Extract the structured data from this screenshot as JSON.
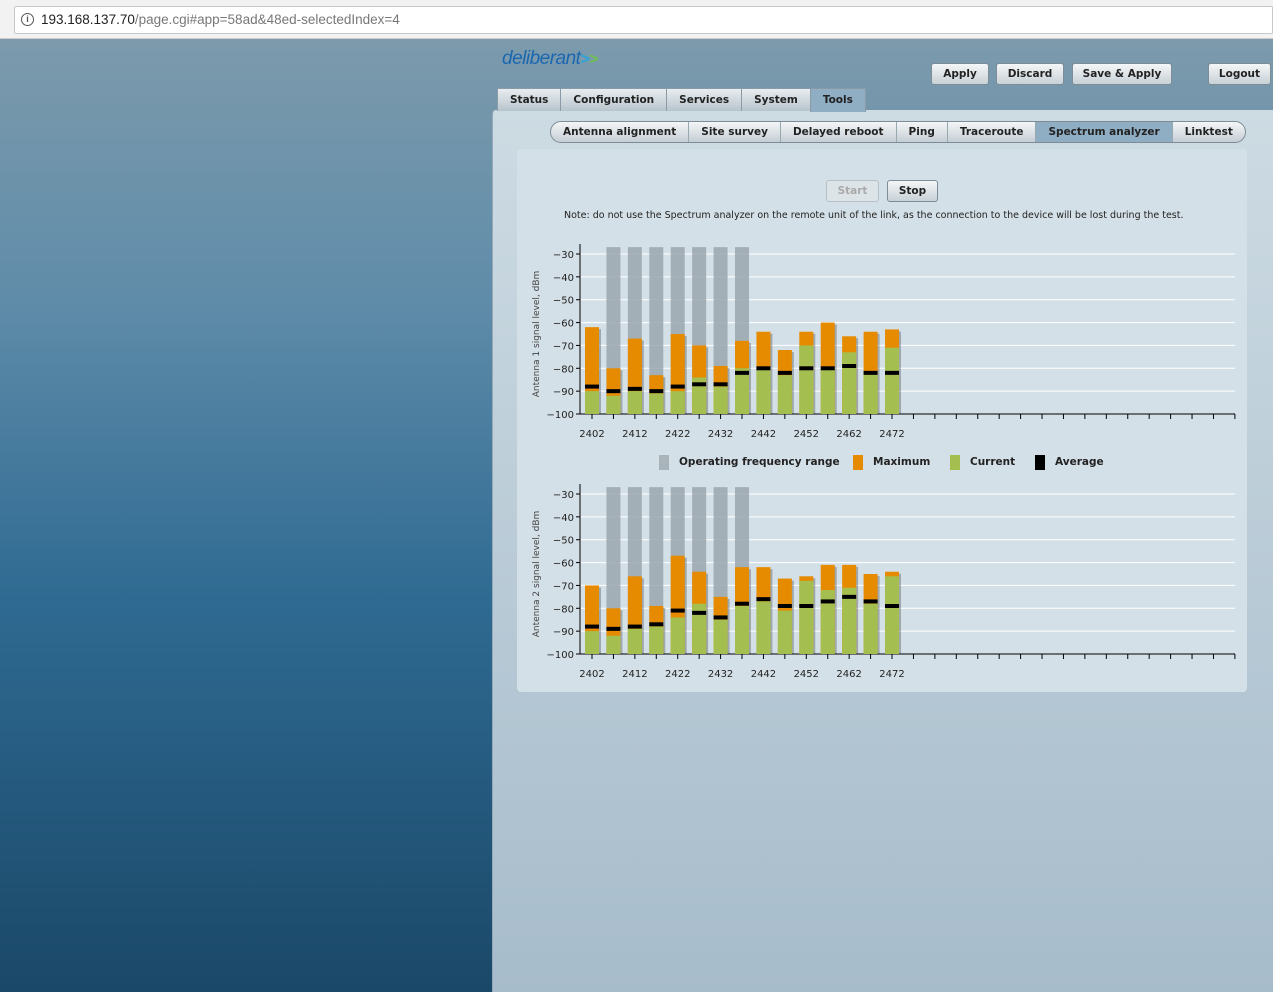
{
  "browser": {
    "url_host": "193.168.137.70",
    "url_path": "/page.cgi#app=58ad&48ed-selectedIndex=4"
  },
  "logo": "deliberant",
  "toolbar": {
    "apply": "Apply",
    "discard": "Discard",
    "save_apply": "Save & Apply",
    "logout": "Logout"
  },
  "tabs": [
    "Status",
    "Configuration",
    "Services",
    "System",
    "Tools"
  ],
  "active_tab": "Tools",
  "subtabs": [
    "Antenna alignment",
    "Site survey",
    "Delayed reboot",
    "Ping",
    "Traceroute",
    "Spectrum analyzer",
    "Linktest"
  ],
  "active_subtab": "Spectrum analyzer",
  "controls": {
    "start": "Start",
    "stop": "Stop"
  },
  "note": "Note: do not use the Spectrum analyzer on the remote unit of the link, as the connection to the device will be lost during the test.",
  "legend": {
    "operating": "Operating frequency range",
    "maximum": "Maximum",
    "current": "Current",
    "average": "Average"
  },
  "colors": {
    "operating": "#9aa6ae",
    "maximum": "#e68a00",
    "current": "#a5be50",
    "average": "#000000"
  },
  "chart_data": [
    {
      "type": "bar",
      "ylabel": "Antenna 1 signal level, dBm",
      "ylim": [
        -100,
        -30
      ],
      "yticks": [
        -30,
        -40,
        -50,
        -60,
        -70,
        -80,
        -90,
        -100
      ],
      "x": [
        2402,
        2407,
        2412,
        2417,
        2422,
        2427,
        2432,
        2437,
        2442,
        2447,
        2452,
        2457,
        2462,
        2467,
        2472
      ],
      "xtick_labels": [
        "2402",
        "2412",
        "2422",
        "2432",
        "2442",
        "2452",
        "2462",
        "2472"
      ],
      "operating_range": [
        2407,
        2437
      ],
      "operating_top": -27,
      "series": [
        {
          "name": "Maximum",
          "values": [
            -62,
            -80,
            -67,
            -83,
            -65,
            -70,
            -79,
            -68,
            -64,
            -72,
            -64,
            -60,
            -66,
            -64,
            -63
          ]
        },
        {
          "name": "Current",
          "values": [
            -90,
            -92,
            -90,
            -91,
            -90,
            -84,
            -88,
            -80,
            -80,
            -83,
            -70,
            -80,
            -73,
            -82,
            -71
          ]
        },
        {
          "name": "Average",
          "values": [
            -88,
            -90,
            -89,
            -90,
            -88,
            -87,
            -87,
            -82,
            -80,
            -82,
            -80,
            -80,
            -79,
            -82,
            -82
          ]
        }
      ]
    },
    {
      "type": "bar",
      "ylabel": "Antenna 2 signal level, dBm",
      "ylim": [
        -100,
        -30
      ],
      "yticks": [
        -30,
        -40,
        -50,
        -60,
        -70,
        -80,
        -90,
        -100
      ],
      "x": [
        2402,
        2407,
        2412,
        2417,
        2422,
        2427,
        2432,
        2437,
        2442,
        2447,
        2452,
        2457,
        2462,
        2467,
        2472
      ],
      "xtick_labels": [
        "2402",
        "2412",
        "2422",
        "2432",
        "2442",
        "2452",
        "2462",
        "2472"
      ],
      "operating_range": [
        2407,
        2437
      ],
      "operating_top": -27,
      "series": [
        {
          "name": "Maximum",
          "values": [
            -70,
            -80,
            -66,
            -79,
            -57,
            -64,
            -75,
            -62,
            -62,
            -67,
            -66,
            -61,
            -61,
            -65,
            -64
          ]
        },
        {
          "name": "Current",
          "values": [
            -90,
            -92,
            -89,
            -88,
            -84,
            -78,
            -85,
            -79,
            -77,
            -81,
            -68,
            -72,
            -71,
            -78,
            -66
          ]
        },
        {
          "name": "Average",
          "values": [
            -88,
            -89,
            -88,
            -87,
            -81,
            -82,
            -84,
            -78,
            -76,
            -79,
            -79,
            -77,
            -75,
            -77,
            -79
          ]
        }
      ]
    }
  ]
}
